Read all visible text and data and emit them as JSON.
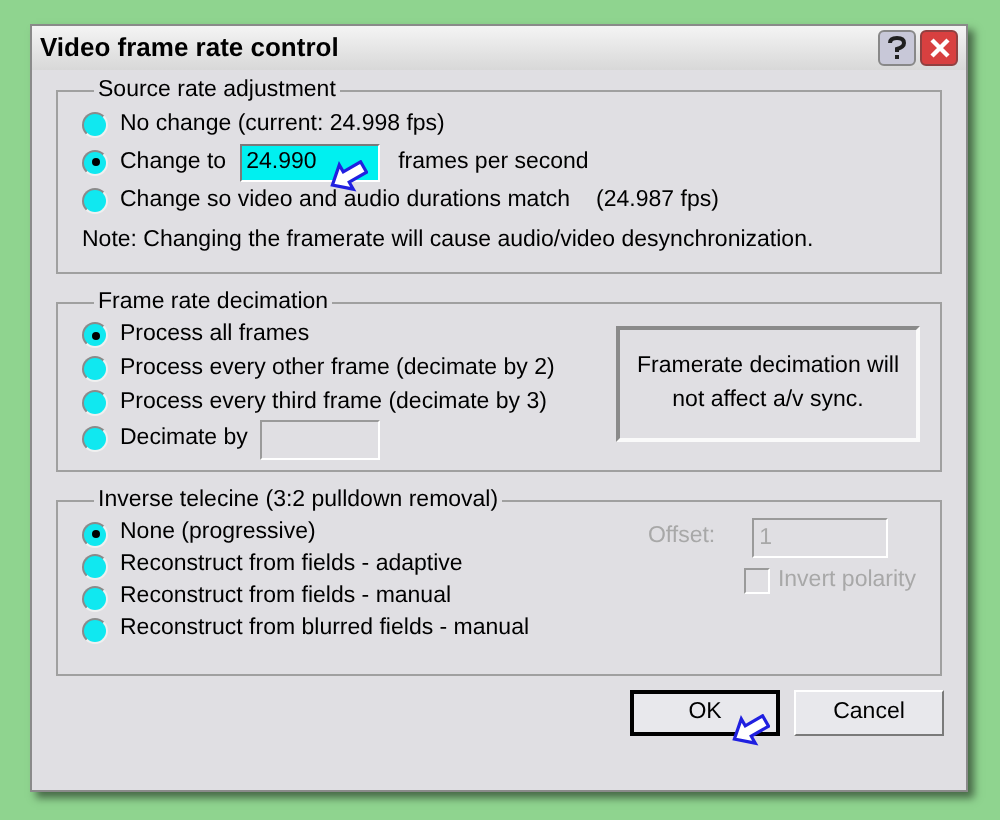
{
  "window": {
    "title": "Video frame rate control"
  },
  "source": {
    "title": "Source rate adjustment",
    "options": [
      {
        "kind": "plain",
        "label": "No change (current: 24.998 fps)",
        "selected": false
      },
      {
        "kind": "field",
        "label": "Change to",
        "value": "24.990",
        "suffix": "frames per second",
        "selected": true
      },
      {
        "kind": "reading",
        "label": "Change so video and audio durations match",
        "reading": "(24.987 fps)",
        "selected": false
      }
    ],
    "note": "Note: Changing the framerate will cause audio/video desynchronization."
  },
  "decimation": {
    "title": "Frame rate decimation",
    "options": [
      {
        "kind": "plain",
        "label": "Process all frames",
        "selected": true
      },
      {
        "kind": "plain",
        "label": "Process every other frame (decimate by 2)",
        "selected": false
      },
      {
        "kind": "plain",
        "label": "Process every third frame (decimate by 3)",
        "selected": false
      },
      {
        "kind": "field",
        "label": "Decimate by",
        "selected": false
      }
    ],
    "info": "Framerate decimation will not affect a/v sync."
  },
  "telecine": {
    "title": "Inverse telecine (3:2 pulldown removal)",
    "options": [
      {
        "kind": "plain",
        "label": "None (progressive)",
        "selected": true
      },
      {
        "kind": "plain",
        "label": "Reconstruct from fields - adaptive",
        "selected": false
      },
      {
        "kind": "plain",
        "label": "Reconstruct from fields - manual",
        "selected": false
      },
      {
        "kind": "plain",
        "label": "Reconstruct from blurred fields - manual",
        "selected": false
      }
    ],
    "offset": {
      "label": "Offset:",
      "value": "1",
      "disabled": true
    },
    "invert": {
      "label": "Invert polarity",
      "checked": false,
      "disabled": true
    }
  },
  "buttons": [
    {
      "label": "OK",
      "default": true
    },
    {
      "label": "Cancel",
      "default": false
    }
  ]
}
